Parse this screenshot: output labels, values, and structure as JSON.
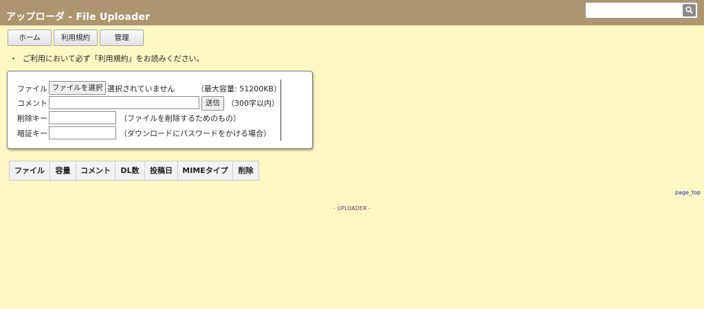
{
  "header": {
    "title": "アップローダ - File Uploader",
    "search": {
      "placeholder": "",
      "button_icon": "search-icon"
    }
  },
  "nav": {
    "items": [
      {
        "label": "ホーム"
      },
      {
        "label": "利用規約"
      },
      {
        "label": "管理"
      }
    ]
  },
  "notice": {
    "bullet": "・",
    "text": "ご利用において必ず「利用規約」をお読みください。"
  },
  "form": {
    "file": {
      "label": "ファイル",
      "button": "ファイルを選択",
      "status": "選択されていません",
      "limit": "（最大容量: 51200KB）"
    },
    "comment": {
      "label": "コメント",
      "value": "",
      "send": "送信",
      "limit": "（300字以内）"
    },
    "delete_key": {
      "label": "削除キー",
      "value": "",
      "hint": "（ファイルを削除するためのもの）"
    },
    "auth_key": {
      "label": "暗証キー",
      "value": "",
      "hint": "（ダウンロードにパスワードをかける場合）"
    }
  },
  "table": {
    "headers": [
      "ファイル",
      "容量",
      "コメント",
      "DL数",
      "投稿日",
      "MIMEタイプ",
      "削除"
    ]
  },
  "links": {
    "page_top": "page_top"
  },
  "footer": {
    "text": "- UPLOADER -"
  },
  "colors": {
    "background": "#fff8c4",
    "header": "#ad9570",
    "search_button": "#8a8a8a",
    "link": "#1a1aa8",
    "footer": "#662e77"
  }
}
